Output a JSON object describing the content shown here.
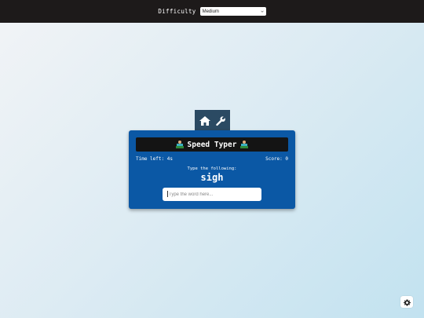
{
  "header": {
    "difficulty_label": "Difficulty",
    "difficulty_value": "Medium"
  },
  "toolbar": {
    "icons": [
      "home-icon",
      "wrench-icon"
    ]
  },
  "game": {
    "title": "Speed Typer",
    "title_emoji": "technologist-emoji",
    "time_left": "Time left: 4s",
    "score": "Score: 0",
    "prompt_label": "Type the following:",
    "word": "sigh",
    "input_placeholder": "Type the word here...",
    "input_value": ""
  },
  "settings": {
    "icon": "gear-icon"
  },
  "colors": {
    "topbar": "#1d1a1a",
    "card": "#0b58a5",
    "title_bar": "#141414",
    "tab_box": "#2b4a63"
  }
}
